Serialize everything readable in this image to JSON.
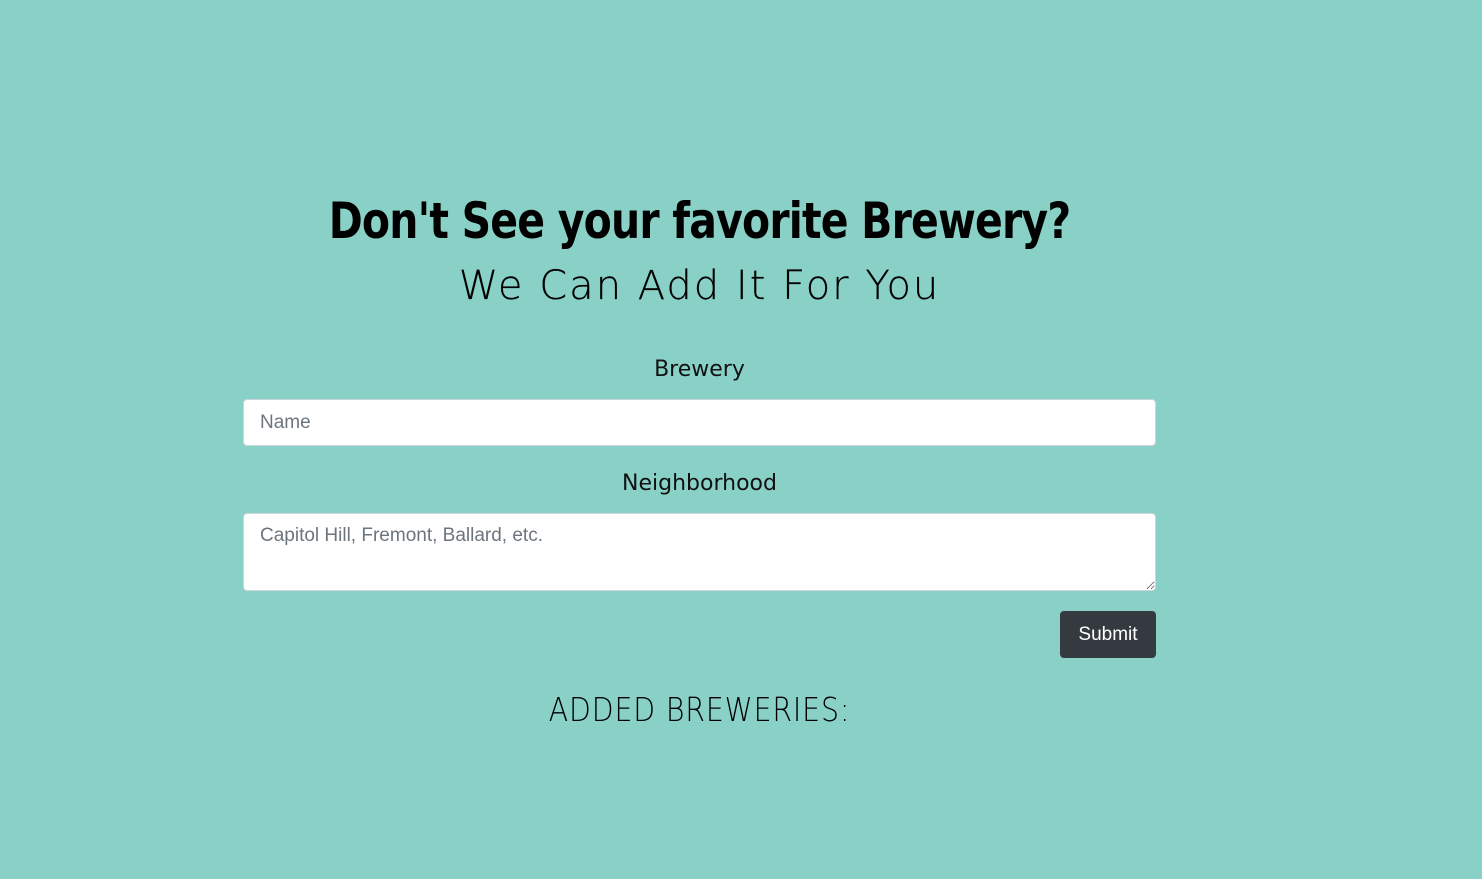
{
  "page": {
    "background_color": "#89d1c6",
    "headline": "Don't See your favorite Brewery?",
    "subheadline": "We Can Add It For You"
  },
  "form": {
    "brewery_label": "Brewery",
    "brewery_placeholder": "Name",
    "brewery_value": "",
    "neighborhood_label": "Neighborhood",
    "neighborhood_placeholder": "Capitol Hill, Fremont, Ballard, etc.",
    "neighborhood_value": "",
    "submit_label": "Submit",
    "submit_color": "#343a40"
  },
  "added": {
    "title": "ADDED BREWERIES:",
    "items": []
  }
}
